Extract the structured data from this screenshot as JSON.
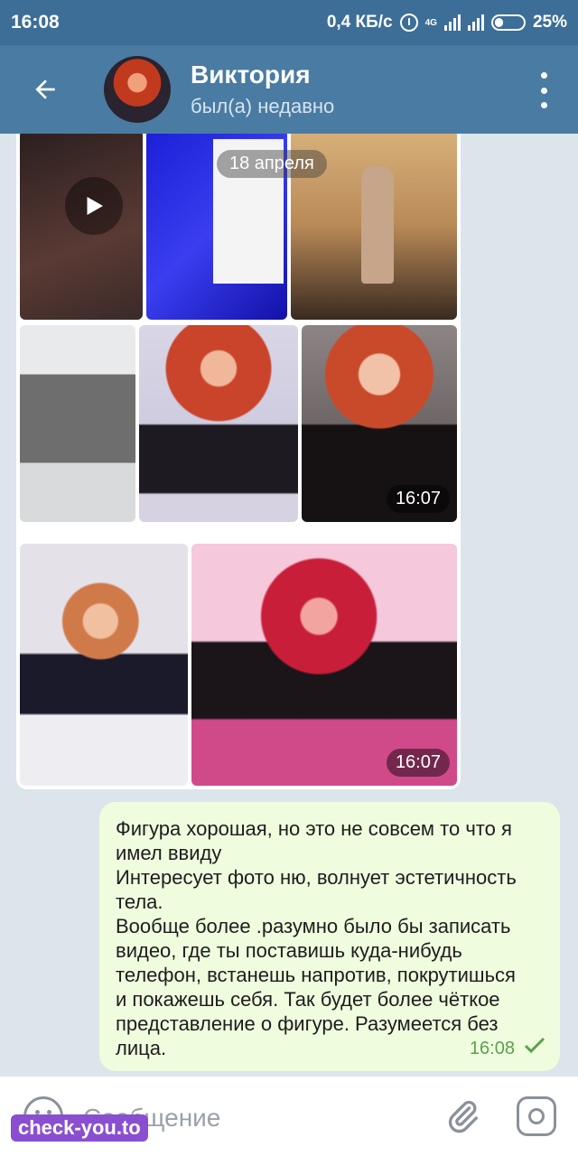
{
  "status_bar": {
    "time": "16:08",
    "speed": "0,4 КБ/с",
    "network_type": "4G",
    "battery": "25%"
  },
  "header": {
    "name": "Виктория",
    "status": "был(а) недавно"
  },
  "chat": {
    "date_label": "18 апреля",
    "photo_group_1_time": "16:07",
    "photo_group_2_time": "16:07",
    "message": {
      "lines": [
        "Фигура хорошая, но это не совсем то что я",
        "имел ввиду",
        "Интересует фото ню, волнует эстетичность",
        "тела.",
        "Вообще более .разумно было бы записать",
        "видео, где ты поставишь куда-нибудь",
        "телефон, встанешь напротив, покрутишься",
        "и покажешь себя. Так будет более чёткое",
        "представление о фигуре. Разумеется без",
        "лица."
      ],
      "time": "16:08"
    }
  },
  "input": {
    "placeholder": "Сообщение"
  },
  "watermark": "check-you.to",
  "colors": {
    "header": "#4a7ba2",
    "status_bar": "#3c6e97",
    "outgoing_bubble": "#effdde",
    "read_check": "#5aa14e"
  },
  "icons": {
    "back": "back-arrow-icon",
    "menu": "more-vert-icon",
    "emoji": "emoji-icon",
    "attach": "paperclip-icon",
    "camera": "camera-icon",
    "play": "play-icon",
    "read": "check-icon"
  }
}
